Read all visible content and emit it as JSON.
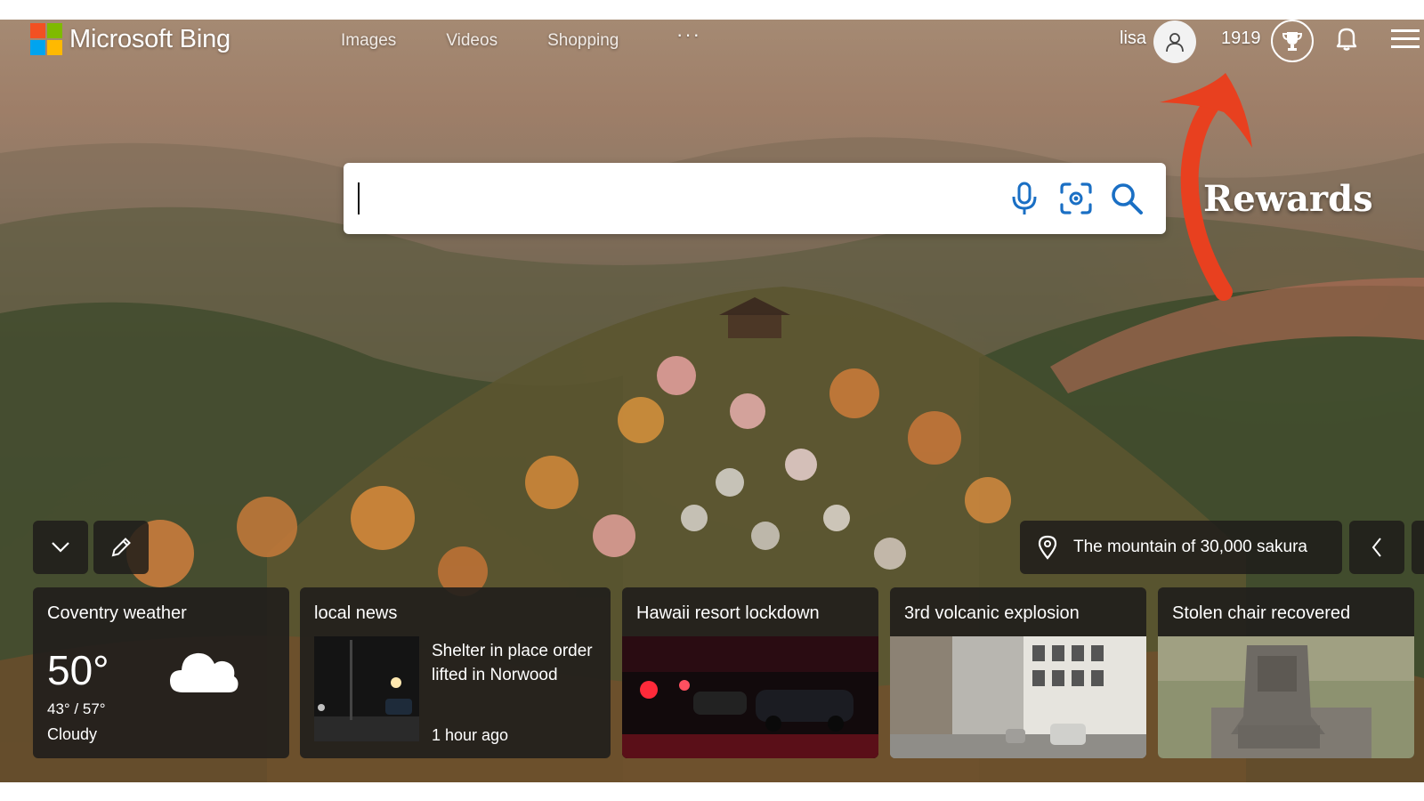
{
  "brand": {
    "name": "Microsoft Bing",
    "logo_colors": [
      "#f25022",
      "#7fba00",
      "#00a4ef",
      "#ffb900"
    ]
  },
  "nav": {
    "items": [
      {
        "label": "Images"
      },
      {
        "label": "Videos"
      },
      {
        "label": "Shopping"
      }
    ],
    "more_label": "···"
  },
  "account": {
    "user_name": "lisa",
    "reward_points": "1919"
  },
  "icons": {
    "avatar": "person-icon",
    "rewards": "trophy-icon",
    "notifications": "bell-icon",
    "menu": "hamburger-icon",
    "microphone": "mic-icon",
    "visual_search": "camera-scan-icon",
    "search": "search-icon"
  },
  "search": {
    "value": "",
    "placeholder": ""
  },
  "annotation": {
    "label": "Rewards",
    "arrow_color": "#e8401f"
  },
  "image_info": {
    "title": "The mountain of 30,000 sakura"
  },
  "cards": {
    "weather": {
      "title": "Coventry weather",
      "temp": "50°",
      "range": "43° / 57°",
      "condition": "Cloudy"
    },
    "local_news": {
      "title": "local news",
      "headline": "Shelter in place order lifted in Norwood",
      "time": "1 hour ago"
    },
    "story1": {
      "title": "Hawaii resort lockdown"
    },
    "story2": {
      "title": "3rd volcanic explosion"
    },
    "story3": {
      "title": "Stolen chair recovered"
    }
  }
}
